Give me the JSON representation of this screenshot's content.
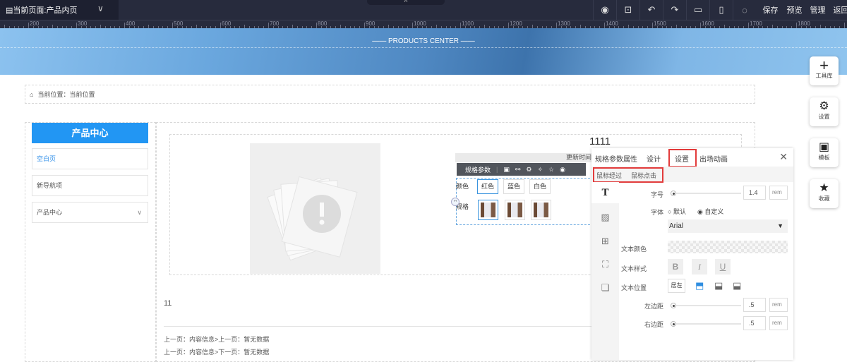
{
  "topbar": {
    "current_page": "当前页面:产品内页",
    "buttons": [
      "保存",
      "预览",
      "管理",
      "返回"
    ],
    "icons": [
      "eye-icon",
      "layout-icon",
      "undo-icon",
      "redo-icon",
      "desktop-icon",
      "mobile-icon",
      "support-icon"
    ]
  },
  "ruler": {
    "labels": [
      "200",
      "300",
      "400",
      "500",
      "600",
      "700",
      "800",
      "900",
      "1000",
      "1100",
      "1200",
      "1300",
      "1400",
      "1500",
      "1600",
      "1700",
      "1800"
    ]
  },
  "banner": {
    "title": "PRODUCTS CENTER"
  },
  "breadcrumb": {
    "text": "当前位置：当前位置"
  },
  "sidebar": {
    "title": "产品中心",
    "items": [
      {
        "label": "空白页"
      },
      {
        "label": "新导航项"
      },
      {
        "label": "产品中心"
      }
    ]
  },
  "product": {
    "title": "1111",
    "update_label": "更新时间",
    "toolbar_label": "规格参数",
    "color_label": "颜色",
    "colors": [
      "红色",
      "蓝色",
      "白色"
    ],
    "spec_label": "规格"
  },
  "content": {
    "number": "11",
    "prev": "上一页：内容信息>上一页：暂无数据",
    "next": "上一页：内容信息>下一页：暂无数据"
  },
  "panel": {
    "tabs": [
      "规格参数属性",
      "设计",
      "设置",
      "出场动画"
    ],
    "subtabs": [
      "鼠标经过",
      "鼠标点击"
    ],
    "font_size_label": "字号",
    "font_size": "1.4",
    "unit": "rem",
    "font_label": "字体",
    "font_default": "默认",
    "font_custom": "自定义",
    "font_value": "Arial",
    "text_color_label": "文本颜色",
    "text_style_label": "文本样式",
    "styles": [
      "B",
      "I",
      "U"
    ],
    "text_pos_label": "文本位置",
    "text_pos_value": "居左",
    "left_margin_label": "左边距",
    "left_margin": ".5",
    "right_margin_label": "右边距",
    "right_margin": ".5"
  },
  "right_tools": [
    "工具库",
    "设置",
    "模板",
    "收藏"
  ]
}
